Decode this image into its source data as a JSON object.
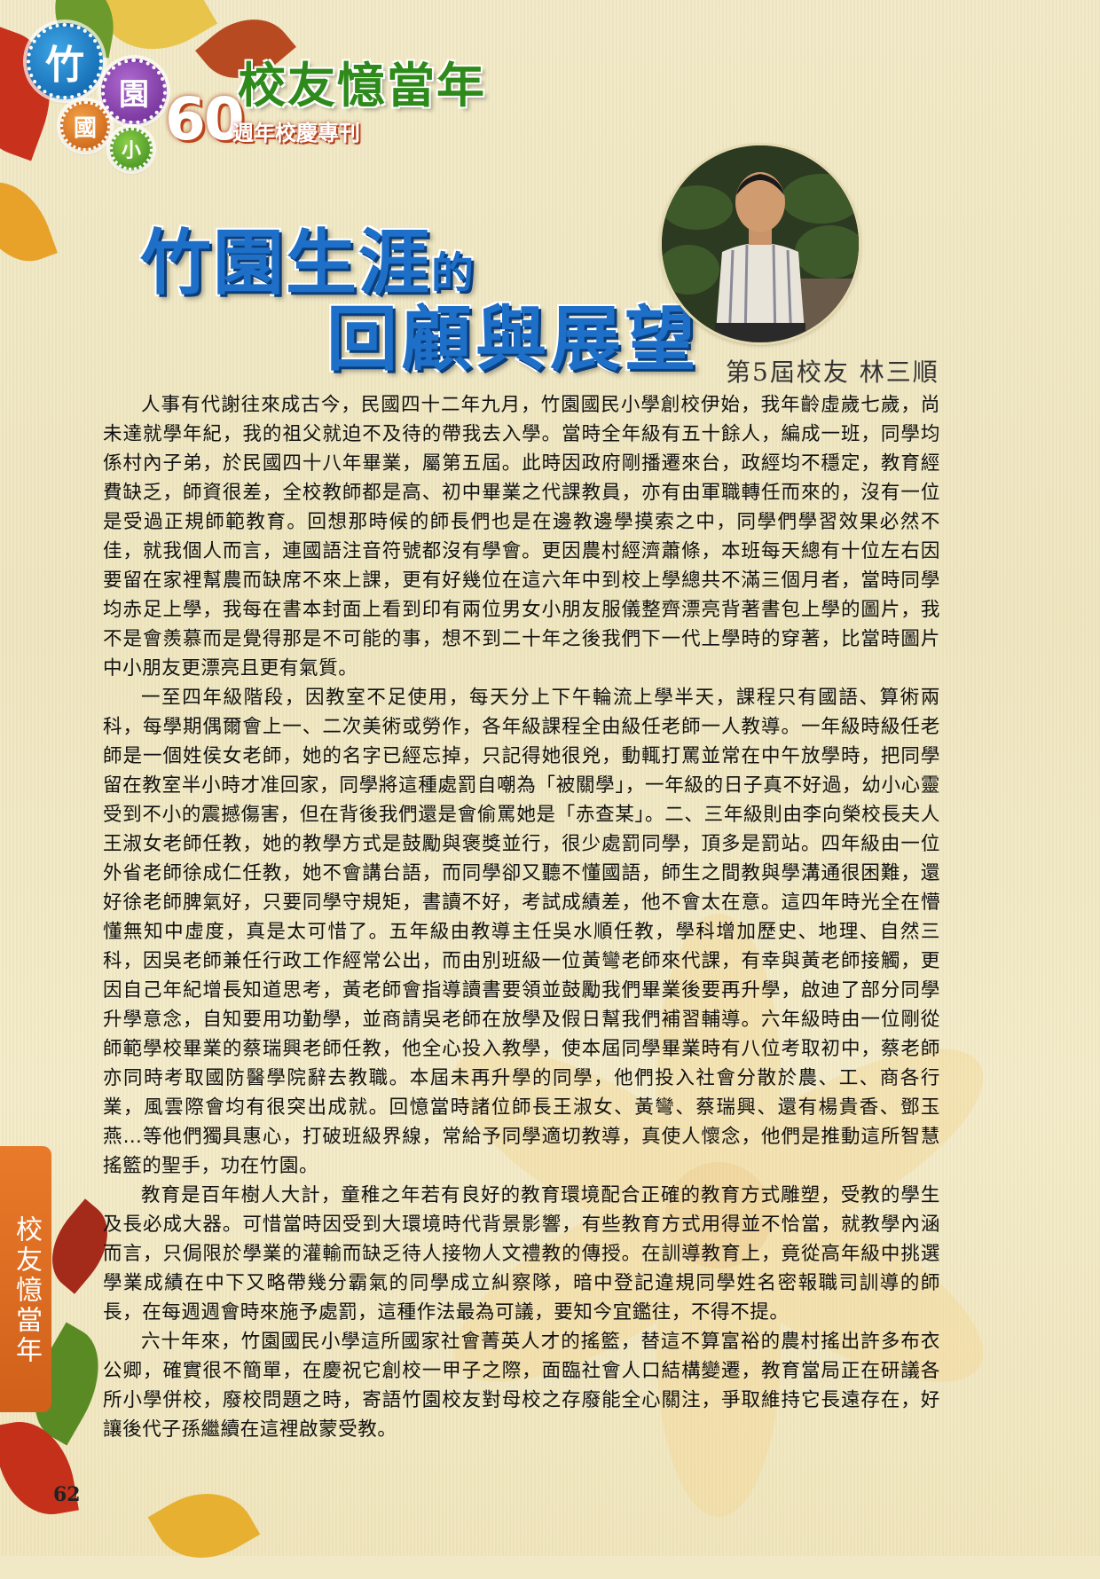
{
  "header": {
    "badge_chars": [
      "竹",
      "園",
      "國",
      "小"
    ],
    "series_title": "校友憶當年",
    "anniversary_number": "60",
    "anniversary_label": "週年校慶專刊"
  },
  "title": {
    "line1_main": "竹園生涯",
    "line1_small": "的",
    "line2": "回顧與展望"
  },
  "byline": "第5屆校友 林三順",
  "article": {
    "paragraphs": [
      "人事有代謝往來成古今，民國四十二年九月，竹園國民小學創校伊始，我年齡虛歲七歲，尚未達就學年紀，我的祖父就迫不及待的帶我去入學。當時全年級有五十餘人，編成一班，同學均係村內子弟，於民國四十八年畢業，屬第五屆。此時因政府剛播遷來台，政經均不穩定，教育經費缺乏，師資很差，全校教師都是高、初中畢業之代課教員，亦有由軍職轉任而來的，沒有一位是受過正規師範教育。回想那時候的師長們也是在邊教邊學摸索之中，同學們學習效果必然不佳，就我個人而言，連國語注音符號都沒有學會。更因農村經濟蕭條，本班每天總有十位左右因要留在家裡幫農而缺席不來上課，更有好幾位在這六年中到校上學總共不滿三個月者，當時同學均赤足上學，我每在書本封面上看到印有兩位男女小朋友服儀整齊漂亮背著書包上學的圖片，我不是會羨慕而是覺得那是不可能的事，想不到二十年之後我們下一代上學時的穿著，比當時圖片中小朋友更漂亮且更有氣質。",
      "一至四年級階段，因教室不足使用，每天分上下午輪流上學半天，課程只有國語、算術兩科，每學期偶爾會上一、二次美術或勞作，各年級課程全由級任老師一人教導。一年級時級任老師是一個姓侯女老師，她的名字已經忘掉，只記得她很兇，動輒打罵並常在中午放學時，把同學留在教室半小時才准回家，同學將這種處罰自嘲為「被關學」，一年級的日子真不好過，幼小心靈受到不小的震撼傷害，但在背後我們還是會偷罵她是「赤查某」。二、三年級則由李向榮校長夫人王淑女老師任教，她的教學方式是鼓勵與褒獎並行，很少處罰同學，頂多是罰站。四年級由一位外省老師徐成仁任教，她不會講台語，而同學卻又聽不懂國語，師生之間教與學溝通很困難，還好徐老師脾氣好，只要同學守規矩，書讀不好，考試成績差，他不會太在意。這四年時光全在懵懂無知中虛度，真是太可惜了。五年級由教導主任吳水順任教，學科增加歷史、地理、自然三科，因吳老師兼任行政工作經常公出，而由別班級一位黃彎老師來代課，有幸與黃老師接觸，更因自己年紀增長知道思考，黃老師會指導讀書要領並鼓勵我們畢業後要再升學，啟迪了部分同學升學意念，自知要用功勤學，並商請吳老師在放學及假日幫我們補習輔導。六年級時由一位剛從師範學校畢業的蔡瑞興老師任教，他全心投入教學，使本屆同學畢業時有八位考取初中，蔡老師亦同時考取國防醫學院辭去教職。本屆未再升學的同學，他們投入社會分散於農、工、商各行業，風雲際會均有很突出成就。回憶當時諸位師長王淑女、黃彎、蔡瑞興、還有楊貴香、鄧玉燕…等他們獨具惠心，打破班級界線，常給予同學適切教導，真使人懷念，他們是推動這所智慧搖籃的聖手，功在竹園。",
      "教育是百年樹人大計，童稚之年若有良好的教育環境配合正確的教育方式雕塑，受教的學生及長必成大器。可惜當時因受到大環境時代背景影響，有些教育方式用得並不恰當，就教學內涵而言，只侷限於學業的灌輸而缺乏待人接物人文禮教的傳授。在訓導教育上，竟從高年級中挑選學業成績在中下又略帶幾分霸氣的同學成立糾察隊，暗中登記違規同學姓名密報職司訓導的師長，在每週週會時來施予處罰，這種作法最為可議，要知今宜鑑往，不得不提。",
      "六十年來，竹園國民小學這所國家社會菁英人才的搖籃，替這不算富裕的農村搖出許多布衣公卿，確實很不簡單，在慶祝它創校一甲子之際，面臨社會人口結構變遷，教育當局正在研議各所小學併校，廢校問題之時，寄語竹園校友對母校之存廢能全心關注，爭取維持它長遠存在，好讓後代子孫繼續在這裡啟蒙受教。"
    ]
  },
  "side_tab": "校友憶當年",
  "page_number": "62",
  "colors": {
    "title_blue": "#1d6fc8",
    "series_green": "#2e8a1a",
    "tab_orange": "#e87a2a"
  }
}
